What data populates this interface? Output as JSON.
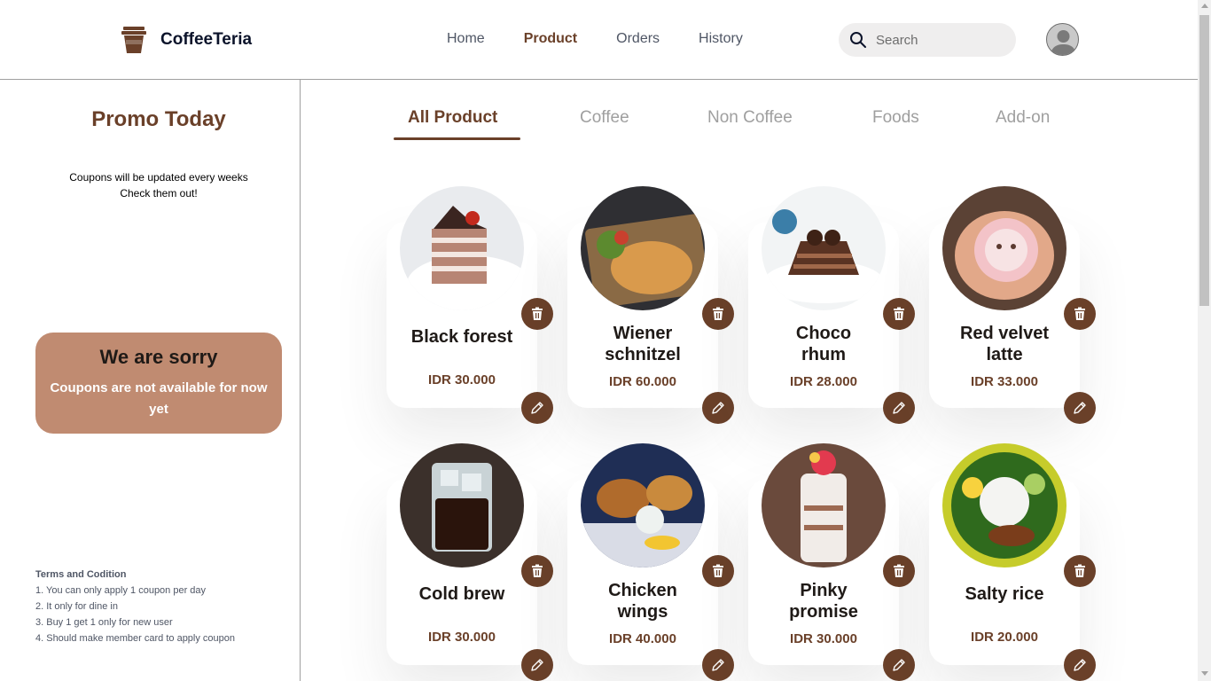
{
  "brand": {
    "name": "CoffeeTeria"
  },
  "nav": {
    "items": [
      {
        "label": "Home",
        "active": false
      },
      {
        "label": "Product",
        "active": true
      },
      {
        "label": "Orders",
        "active": false
      },
      {
        "label": "History",
        "active": false
      }
    ]
  },
  "search": {
    "placeholder": "Search",
    "icon": "search-icon"
  },
  "promo": {
    "title": "Promo Today",
    "note_line1": "Coupons will be updated every weeks",
    "note_line2": "Check them out!",
    "sorry_title": "We are sorry",
    "sorry_text": "Coupons are not available for now yet"
  },
  "terms": {
    "title": "Terms and Codition",
    "items": [
      "1. You can only apply 1 coupon per day",
      "2. It only for dine in",
      "3. Buy 1 get 1 only for new user",
      "4. Should make member card to apply coupon"
    ]
  },
  "tabs": [
    {
      "label": "All Product",
      "active": true
    },
    {
      "label": "Coffee",
      "active": false
    },
    {
      "label": "Non Coffee",
      "active": false
    },
    {
      "label": "Foods",
      "active": false
    },
    {
      "label": "Add-on",
      "active": false
    }
  ],
  "products": [
    {
      "name_line1": "Black forest",
      "name_line2": "",
      "price": "IDR 30.000"
    },
    {
      "name_line1": "Wiener",
      "name_line2": "schnitzel",
      "price": "IDR 60.000"
    },
    {
      "name_line1": "Choco",
      "name_line2": "rhum",
      "price": "IDR 28.000"
    },
    {
      "name_line1": "Red velvet",
      "name_line2": "latte",
      "price": "IDR 33.000"
    },
    {
      "name_line1": "Cold brew",
      "name_line2": "",
      "price": "IDR 30.000"
    },
    {
      "name_line1": "Chicken",
      "name_line2": "wings",
      "price": "IDR 40.000"
    },
    {
      "name_line1": "Pinky",
      "name_line2": "promise",
      "price": "IDR 30.000"
    },
    {
      "name_line1": "Salty rice",
      "name_line2": "",
      "price": "IDR 20.000"
    }
  ],
  "colors": {
    "brand_brown": "#6a4029",
    "promo_card": "#c08b71",
    "dark_text": "#1f1a17",
    "muted": "#9f9f9f"
  }
}
